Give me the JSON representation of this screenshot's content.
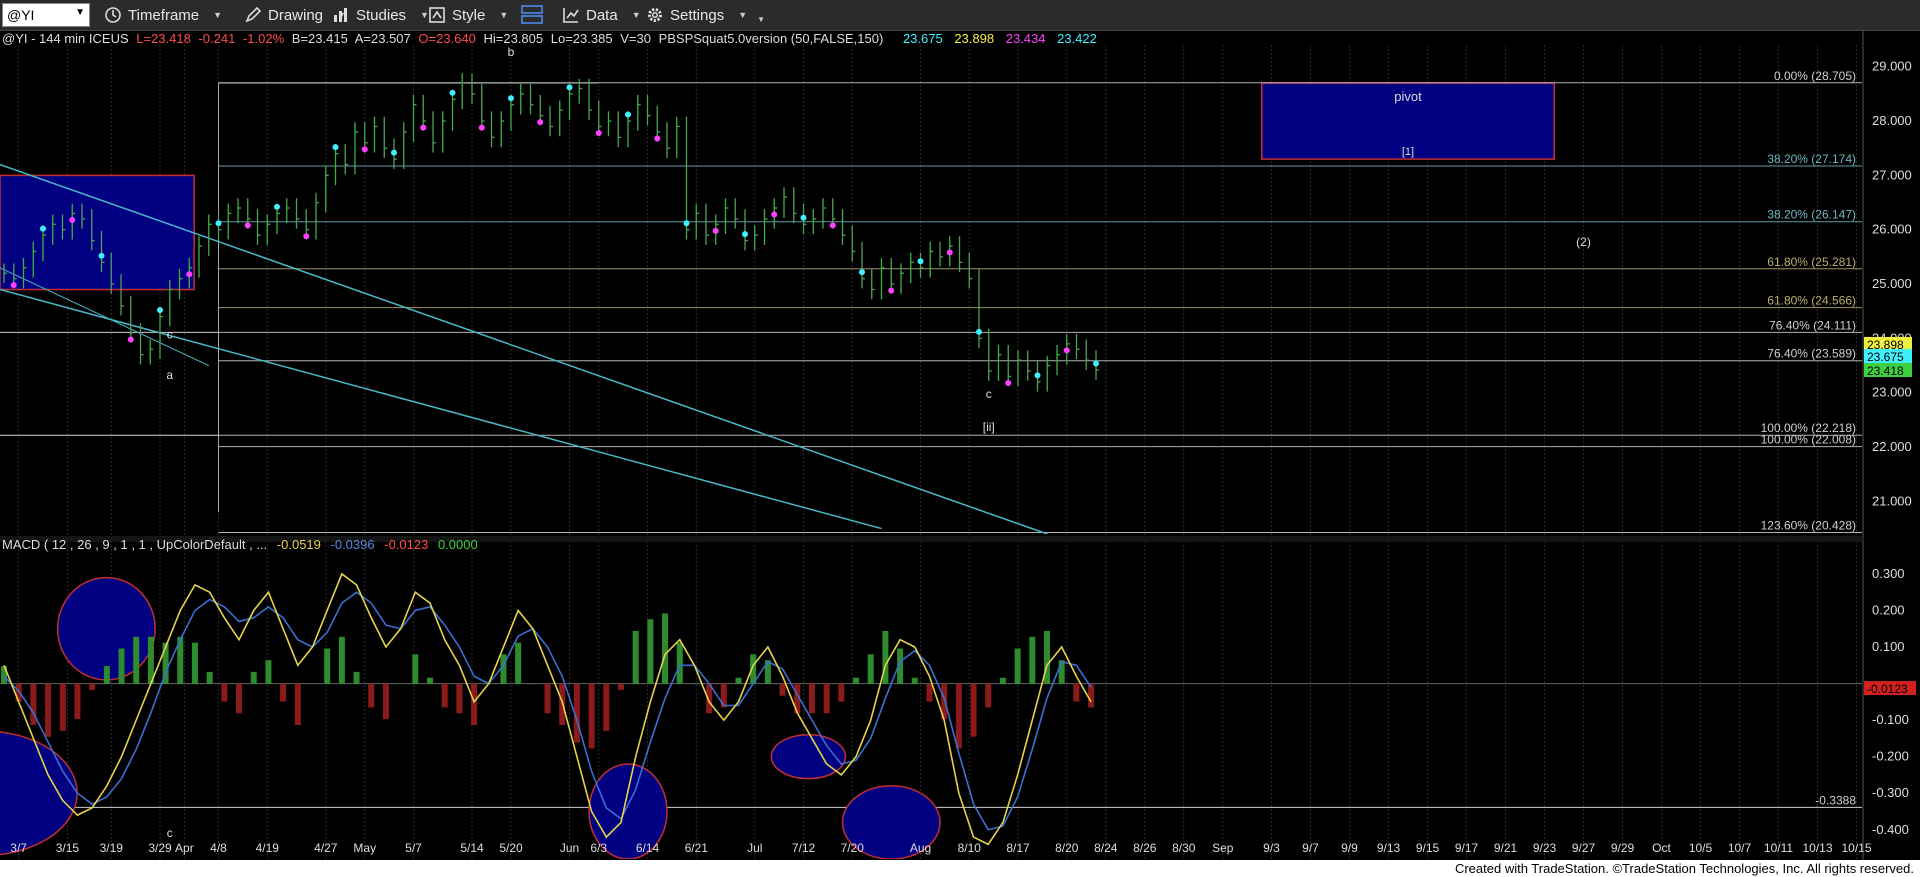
{
  "toolbar": {
    "symbol": "@YI",
    "timeframe": "Timeframe",
    "drawing": "Drawing",
    "studies": "Studies",
    "style": "Style",
    "data": "Data",
    "settings": "Settings"
  },
  "header": {
    "symbol_line": "@YI - 144 min  ICEUS",
    "last": "L=23.418",
    "change": "-0.241",
    "pct": "-1.02%",
    "bid": "B=23.415",
    "ask": "A=23.507",
    "open": "O=23.640",
    "high": "Hi=23.805",
    "low": "Lo=23.385",
    "volume": "V=30",
    "study": "PBSPSquat5.0version (50,FALSE,150)",
    "v1": "23.675",
    "v2": "23.898",
    "v3": "23.434",
    "v4": "23.422"
  },
  "macd_header": {
    "label": "MACD ( 12 , 26 , 9 , 1 , 1 , UpColorDefault , ...",
    "v1": "-0.0519",
    "v2": "-0.0396",
    "v3": "-0.0123",
    "v4": "0.0000"
  },
  "colors": {
    "up": "#2e8b2e",
    "down": "#8b1a1a",
    "macd_line": "#e6d34a",
    "signal_line": "#3a6fd0",
    "fib_grey": "#cfcfcf",
    "fib_teal": "#6fb6c0",
    "fib_olive": "#b8b070",
    "box_fill": "#000080",
    "box_border": "#c03030",
    "trend": "#4ab7c8",
    "cyan_dot": "#3ff0ff",
    "magenta_dot": "#ff40ff"
  },
  "price_axis": {
    "ticks": [
      "29.000",
      "28.000",
      "27.000",
      "26.000",
      "25.000",
      "24.000",
      "23.000",
      "22.000",
      "21.000"
    ]
  },
  "price_tags": [
    "23.898",
    "23.675",
    "23.418"
  ],
  "macd_axis": {
    "ticks": [
      "0.300",
      "0.200",
      "0.100",
      "-0.100",
      "-0.200",
      "-0.300",
      "-0.400"
    ]
  },
  "macd_tag": "-0.0123",
  "fib_levels": [
    {
      "label": "0.00% (28.705)",
      "value": 28.705,
      "color": "fib_grey"
    },
    {
      "label": "38.20% (27.174)",
      "value": 27.174,
      "color": "fib_teal"
    },
    {
      "label": "38.20% (26.147)",
      "value": 26.147,
      "color": "fib_teal"
    },
    {
      "label": "61.80% (25.281)",
      "value": 25.281,
      "color": "fib_olive"
    },
    {
      "label": "61.80% (24.566)",
      "value": 24.566,
      "color": "fib_olive"
    },
    {
      "label": "76.40% (24.111)",
      "value": 24.111,
      "color": "fib_grey"
    },
    {
      "label": "76.40% (23.589)",
      "value": 23.589,
      "color": "fib_grey"
    },
    {
      "label": "100.00% (22.218)",
      "value": 22.218,
      "color": "fib_grey"
    },
    {
      "label": "100.00% (22.008)",
      "value": 22.008,
      "color": "fib_grey"
    },
    {
      "label": "123.60% (20.428)",
      "value": 20.428,
      "color": "fib_grey"
    }
  ],
  "macd_level": {
    "label": "-0.3388",
    "value": -0.3388
  },
  "wave_labels": [
    {
      "text": "b",
      "x": 52,
      "y": 29.2
    },
    {
      "text": "c",
      "x": 17,
      "y": 24.0
    },
    {
      "text": "a",
      "x": 17,
      "y": 23.25
    },
    {
      "text": "c",
      "x": 101,
      "y": 22.9
    },
    {
      "text": "[ii]",
      "x": 101,
      "y": 22.3
    },
    {
      "text": "(2)",
      "x": 162,
      "y": 25.7
    }
  ],
  "pivot_box": {
    "label": "pivot",
    "sublabel": "[1]",
    "x0": 129,
    "x1": 159,
    "y0": 27.3,
    "y1": 28.7
  },
  "left_box": {
    "x0": 0,
    "x1": 19.5,
    "y0": 24.9,
    "y1": 27.0
  },
  "macd_c_label": {
    "text": "c",
    "x": 17,
    "y": -0.42
  },
  "chart_data": {
    "type": "candlestick",
    "x_labels": [
      "3/7",
      "3/15",
      "3/19",
      "3/29",
      "Apr",
      "4/8",
      "4/19",
      "4/27",
      "May",
      "5/7",
      "5/14",
      "5/20",
      "Jun",
      "6/3",
      "6/14",
      "6/21",
      "Jul",
      "7/12",
      "7/20",
      "Aug",
      "8/10",
      "8/17",
      "8/20",
      "8/24",
      "8/26",
      "8/30",
      "Sep",
      "9/3",
      "9/7",
      "9/9",
      "9/13",
      "9/15",
      "9/17",
      "9/21",
      "9/23",
      "9/27",
      "9/29",
      "Oct",
      "10/5",
      "10/7",
      "10/11",
      "10/13",
      "10/15"
    ],
    "x_label_pos": [
      1.5,
      6.5,
      11,
      16,
      18.5,
      22,
      27,
      33,
      37,
      42,
      48,
      52,
      58,
      61,
      66,
      71,
      77,
      82,
      87,
      94,
      99,
      104,
      109,
      113,
      117,
      121,
      125,
      130,
      134,
      138,
      142,
      146,
      150,
      154,
      158,
      162,
      166,
      170,
      174,
      178,
      182,
      186,
      190
    ],
    "ylim": [
      20.4,
      29.4
    ],
    "macd_ylim": [
      -0.48,
      0.36
    ],
    "closes": [
      25.2,
      25.1,
      25.3,
      25.6,
      25.9,
      26.1,
      26.0,
      26.3,
      26.2,
      25.8,
      25.4,
      25.0,
      24.6,
      24.1,
      23.7,
      23.8,
      24.4,
      24.9,
      25.1,
      25.3,
      25.7,
      26.1,
      26.0,
      26.3,
      26.4,
      26.2,
      25.9,
      26.1,
      26.3,
      26.4,
      26.2,
      26.0,
      26.5,
      27.0,
      27.4,
      27.2,
      27.8,
      27.6,
      27.9,
      27.5,
      27.3,
      27.8,
      28.3,
      28.0,
      27.6,
      28.0,
      28.4,
      28.7,
      28.5,
      28.0,
      27.7,
      28.0,
      28.3,
      28.5,
      28.3,
      28.1,
      27.9,
      28.2,
      28.5,
      28.6,
      28.2,
      27.9,
      28.0,
      27.7,
      28.0,
      28.3,
      28.1,
      27.8,
      27.5,
      27.9,
      26.0,
      26.3,
      25.9,
      26.1,
      26.4,
      26.2,
      25.8,
      25.9,
      26.2,
      26.4,
      26.6,
      26.3,
      26.1,
      26.2,
      26.4,
      26.2,
      25.9,
      25.6,
      25.1,
      24.9,
      25.3,
      25.0,
      25.2,
      25.4,
      25.3,
      25.6,
      25.5,
      25.7,
      25.4,
      25.1,
      24.0,
      23.4,
      23.7,
      23.3,
      23.6,
      23.4,
      23.2,
      23.5,
      23.7,
      23.9,
      23.8,
      23.6,
      23.418
    ],
    "macd": [
      0.05,
      -0.05,
      -0.15,
      -0.25,
      -0.32,
      -0.36,
      -0.34,
      -0.28,
      -0.2,
      -0.1,
      0.0,
      0.1,
      0.2,
      0.27,
      0.25,
      0.18,
      0.12,
      0.2,
      0.25,
      0.15,
      0.05,
      0.1,
      0.2,
      0.3,
      0.27,
      0.18,
      0.1,
      0.15,
      0.25,
      0.22,
      0.12,
      0.05,
      -0.05,
      0.0,
      0.1,
      0.2,
      0.15,
      0.05,
      -0.05,
      -0.2,
      -0.35,
      -0.42,
      -0.38,
      -0.2,
      -0.05,
      0.08,
      0.12,
      0.05,
      -0.05,
      -0.1,
      -0.05,
      0.05,
      0.1,
      0.02,
      -0.08,
      -0.15,
      -0.22,
      -0.25,
      -0.2,
      -0.1,
      0.05,
      0.12,
      0.1,
      0.02,
      -0.1,
      -0.3,
      -0.42,
      -0.44,
      -0.38,
      -0.25,
      -0.1,
      0.05,
      0.1,
      0.02,
      -0.05
    ],
    "signal": [
      0.02,
      -0.02,
      -0.08,
      -0.16,
      -0.24,
      -0.3,
      -0.33,
      -0.31,
      -0.26,
      -0.18,
      -0.08,
      0.03,
      0.12,
      0.2,
      0.23,
      0.21,
      0.17,
      0.18,
      0.21,
      0.18,
      0.12,
      0.1,
      0.14,
      0.22,
      0.25,
      0.22,
      0.16,
      0.15,
      0.2,
      0.21,
      0.16,
      0.1,
      0.02,
      0.0,
      0.05,
      0.13,
      0.15,
      0.1,
      0.02,
      -0.1,
      -0.24,
      -0.34,
      -0.37,
      -0.29,
      -0.16,
      -0.04,
      0.05,
      0.05,
      0.0,
      -0.06,
      -0.06,
      0.0,
      0.06,
      0.04,
      -0.03,
      -0.1,
      -0.17,
      -0.22,
      -0.21,
      -0.15,
      -0.04,
      0.06,
      0.09,
      0.05,
      -0.04,
      -0.19,
      -0.33,
      -0.4,
      -0.39,
      -0.31,
      -0.18,
      -0.04,
      0.06,
      0.05,
      -0.01
    ]
  }
}
